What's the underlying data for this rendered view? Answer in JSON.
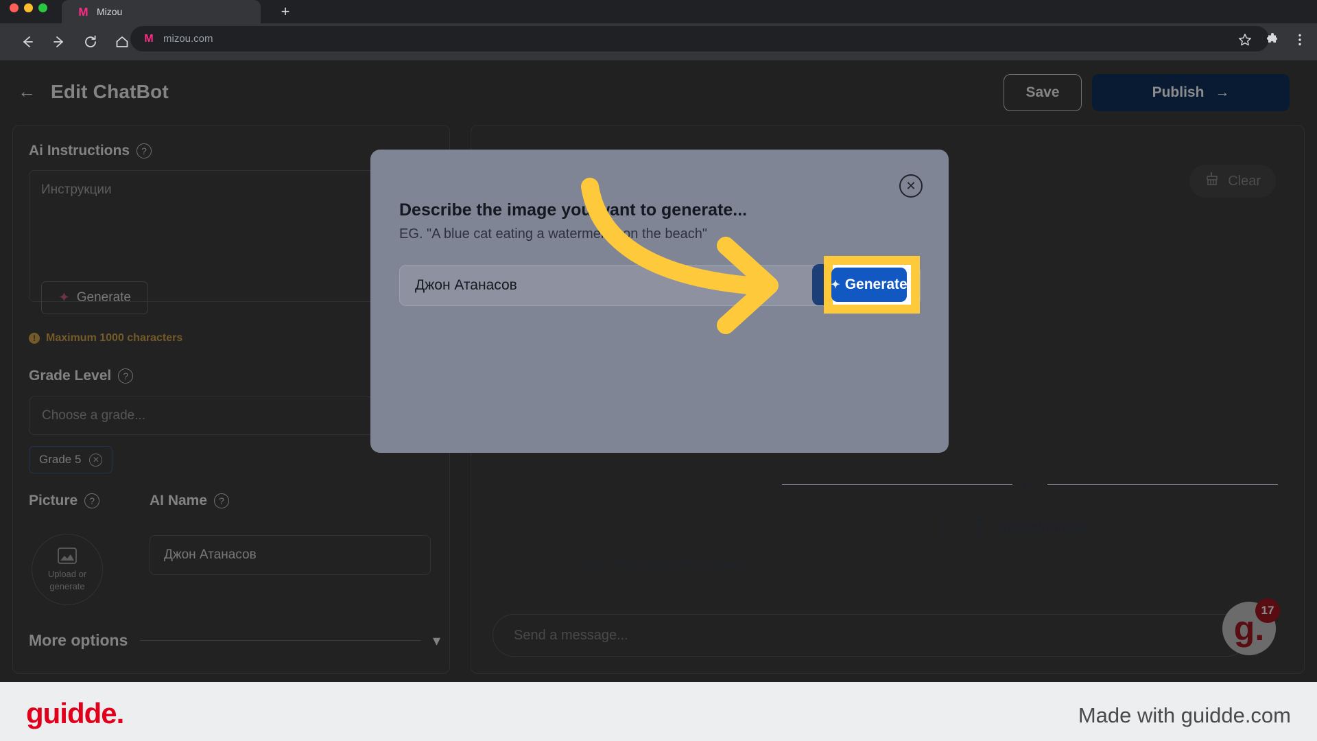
{
  "browser": {
    "tab": {
      "title": "Mizou",
      "favicon": "M"
    },
    "new_tab_label": "+",
    "nav": {
      "back": "back-arrow-icon",
      "forward": "forward-arrow-icon",
      "reload": "reload-icon",
      "home": "home-icon"
    },
    "url": "mizou.com",
    "url_favicon": "M",
    "toolbar_right": [
      "star-icon",
      "extensions-icon",
      "menu-icon"
    ]
  },
  "header": {
    "back_label": "←",
    "title": "Edit ChatBot",
    "save_label": "Save",
    "publish_label": "Publish",
    "publish_arrow": "→"
  },
  "left_panel": {
    "ai_instructions_label": "Ai Instructions",
    "ai_instructions_placeholder": "Инструкции",
    "generate_label": "Generate",
    "max_chars_note": "Maximum 1000 characters",
    "grade_level_label": "Grade Level",
    "grade_placeholder": "Choose a grade...",
    "grade_chip": "Grade 5",
    "picture_label": "Picture",
    "picture_upload_line1": "Upload or",
    "picture_upload_line2": "generate",
    "ai_name_label": "AI Name",
    "ai_name_value": "Джон Атанасов",
    "more_options_label": "More options",
    "help_glyph": "?"
  },
  "right_panel": {
    "clear_label": "Clear",
    "message_placeholder": "Send a message..."
  },
  "modal": {
    "title": "Describe the image you want to generate...",
    "subtitle": "EG. \"A blue cat eating a watermelon on the beach\"",
    "prompt_value": "Джон Атанасов",
    "generate_label": "Generate",
    "or_label": "or",
    "upload_label": "Upload image",
    "format_note": "Only .JPEG and .PNG format",
    "close_glyph": "✕"
  },
  "guidde": {
    "badge_letter": "g.",
    "badge_count": "17",
    "footer_logo": "guidde.",
    "footer_text": "Made with guidde.com"
  },
  "colors": {
    "accent_blue": "#1258c2",
    "publish_blue": "#12305e",
    "highlight_yellow": "#ffc93c",
    "guidde_red": "#e0001b",
    "warning_amber": "#d2a44a",
    "modal_bg": "#7f8594"
  }
}
